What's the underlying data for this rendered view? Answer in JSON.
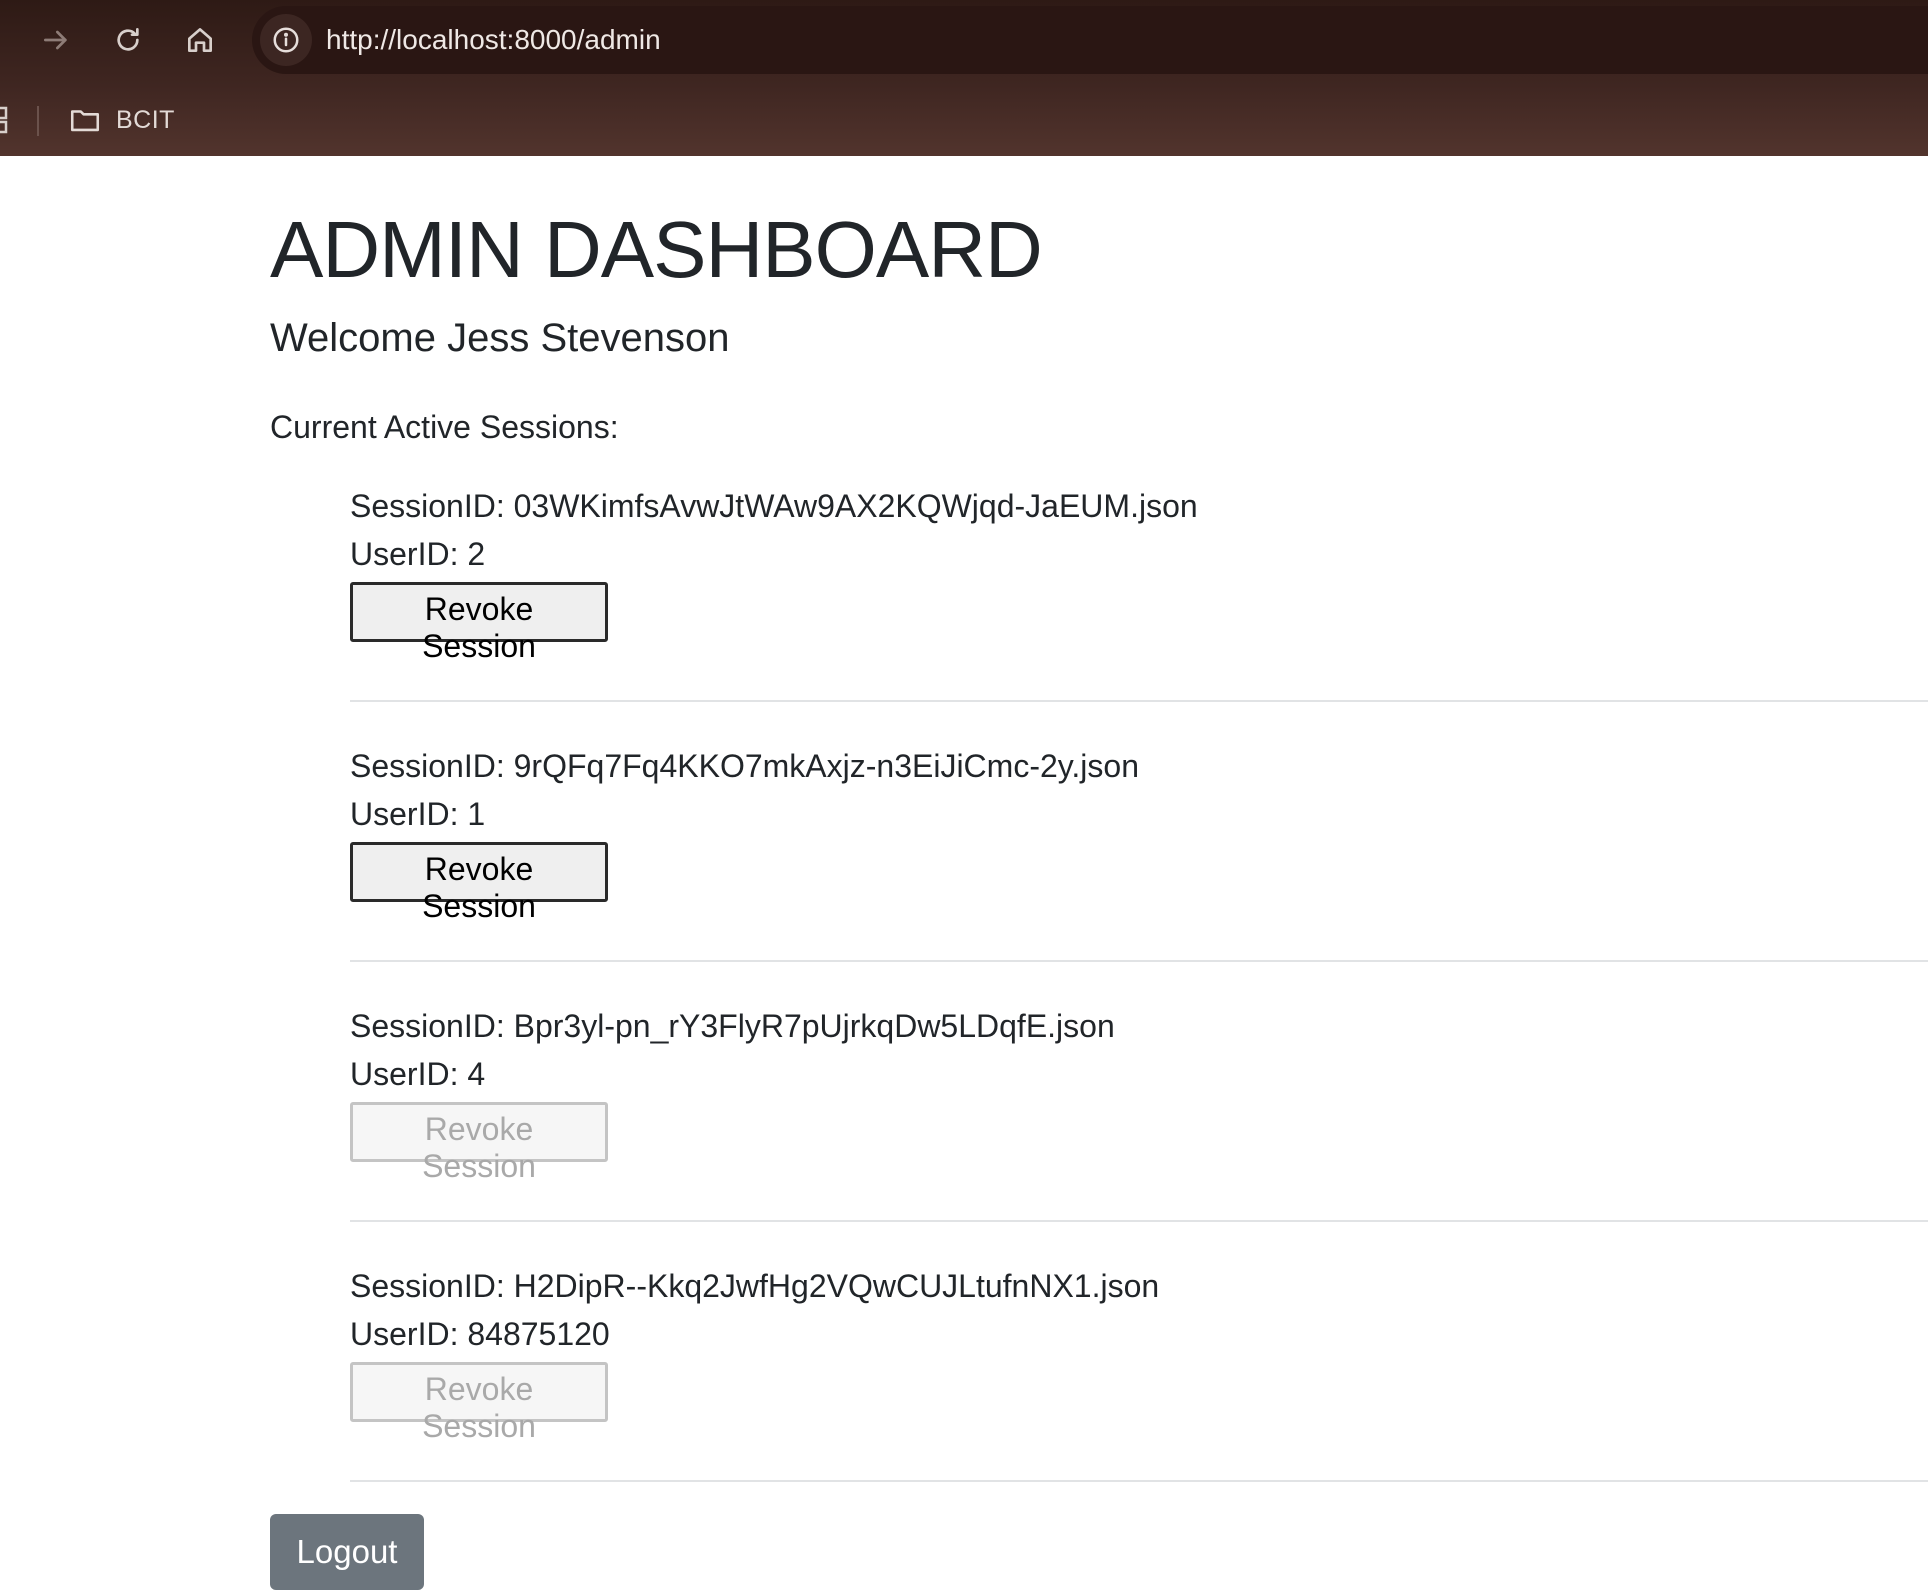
{
  "browser": {
    "url": "http://localhost:8000/admin",
    "bookmarks": [
      {
        "label": "BCIT",
        "icon": "folder-icon"
      }
    ]
  },
  "page": {
    "title": "ADMIN DASHBOARD",
    "welcome": "Welcome Jess Stevenson",
    "sessions_heading": "Current Active Sessions:",
    "sessions": [
      {
        "session_id": "SessionID: 03WKimfsAvwJtWAw9AX2KQWjqd-JaEUM.json",
        "user_id": "UserID: 2",
        "button": "Revoke Session",
        "enabled": true
      },
      {
        "session_id": "SessionID: 9rQFq7Fq4KKO7mkAxjz-n3EiJiCmc-2y.json",
        "user_id": "UserID: 1",
        "button": "Revoke Session",
        "enabled": true
      },
      {
        "session_id": "SessionID: Bpr3yl-pn_rY3FlyR7pUjrkqDw5LDqfE.json",
        "user_id": "UserID: 4",
        "button": "Revoke Session",
        "enabled": false
      },
      {
        "session_id": "SessionID: H2DipR--Kkq2JwfHg2VQwCUJLtufnNX1.json",
        "user_id": "UserID: 84875120",
        "button": "Revoke Session",
        "enabled": false
      }
    ],
    "logout_label": "Logout"
  },
  "colors": {
    "chrome_background": "#3f2621",
    "logout_button": "#6c757d",
    "divider": "#e1e3e5"
  }
}
